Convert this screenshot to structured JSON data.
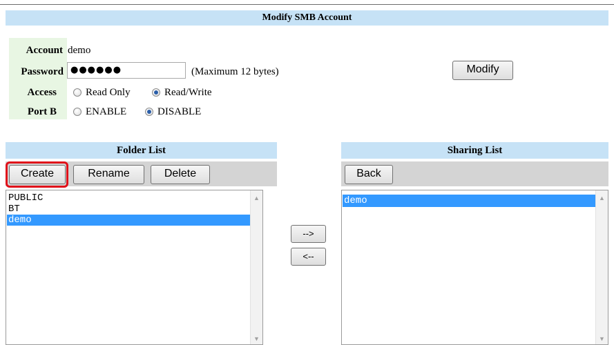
{
  "header": {
    "title": "Modify SMB Account"
  },
  "account": {
    "account_label": "Account",
    "account_value": "demo",
    "password_label": "Password",
    "password_value": "●●●●●●",
    "password_hint": "(Maximum 12 bytes)",
    "access_label": "Access",
    "access_options": [
      {
        "label": "Read Only",
        "selected": false
      },
      {
        "label": "Read/Write",
        "selected": true
      }
    ],
    "portb_label": "Port B",
    "portb_options": [
      {
        "label": "ENABLE",
        "selected": false
      },
      {
        "label": "DISABLE",
        "selected": true
      }
    ],
    "modify_label": "Modify"
  },
  "folder_list": {
    "title": "Folder List",
    "buttons": {
      "create": "Create",
      "rename": "Rename",
      "delete": "Delete"
    },
    "items": [
      {
        "label": "PUBLIC",
        "selected": false
      },
      {
        "label": "BT",
        "selected": false
      },
      {
        "label": "demo",
        "selected": true
      }
    ]
  },
  "transfer": {
    "add_label": "-->",
    "remove_label": "<--"
  },
  "sharing_list": {
    "title": "Sharing List",
    "buttons": {
      "back": "Back"
    },
    "items": [
      {
        "label": "demo",
        "selected": true
      }
    ]
  },
  "colors": {
    "header_bg": "#c6e2f6",
    "label_panel_bg": "#e8f6e3",
    "toolbar_bg": "#d4d4d4",
    "selection": "#3399ff",
    "highlight_border": "#e0101a"
  },
  "icons": {
    "scroll_up": "scroll-up-arrow-icon",
    "scroll_down": "scroll-down-arrow-icon"
  }
}
